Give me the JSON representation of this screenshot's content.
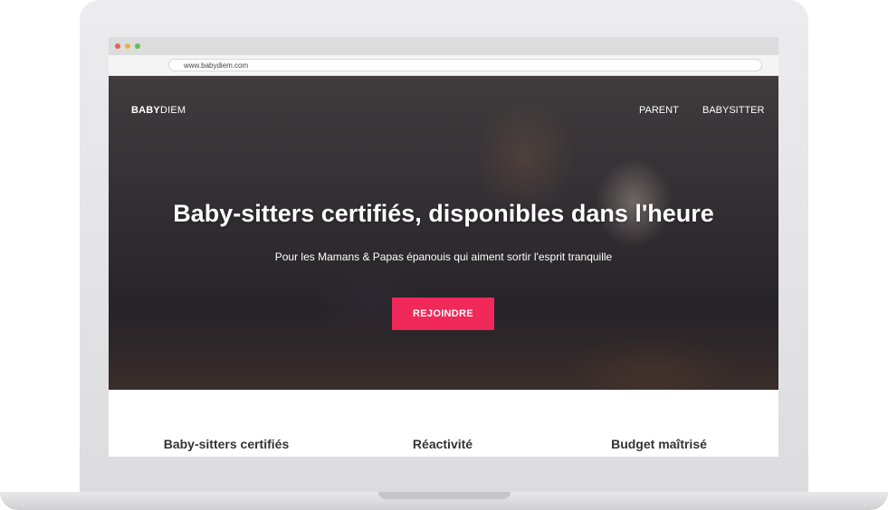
{
  "browser": {
    "url": "www.babydiem.com"
  },
  "brand": {
    "logo_bold": "BABY",
    "logo_light": "DIEM",
    "accent_color": "#f0295a"
  },
  "nav": {
    "items": [
      {
        "label": "PARENT"
      },
      {
        "label": "BABYSITTER"
      }
    ]
  },
  "hero": {
    "headline": "Baby-sitters certifiés, disponibles dans l'heure",
    "subline": "Pour les Mamans & Papas épanouis qui aiment sortir l'esprit tranquille",
    "cta_label": "REJOINDRE"
  },
  "features": [
    {
      "title": "Baby-sitters certifiés"
    },
    {
      "title": "Réactivité"
    },
    {
      "title": "Budget maîtrisé"
    }
  ]
}
